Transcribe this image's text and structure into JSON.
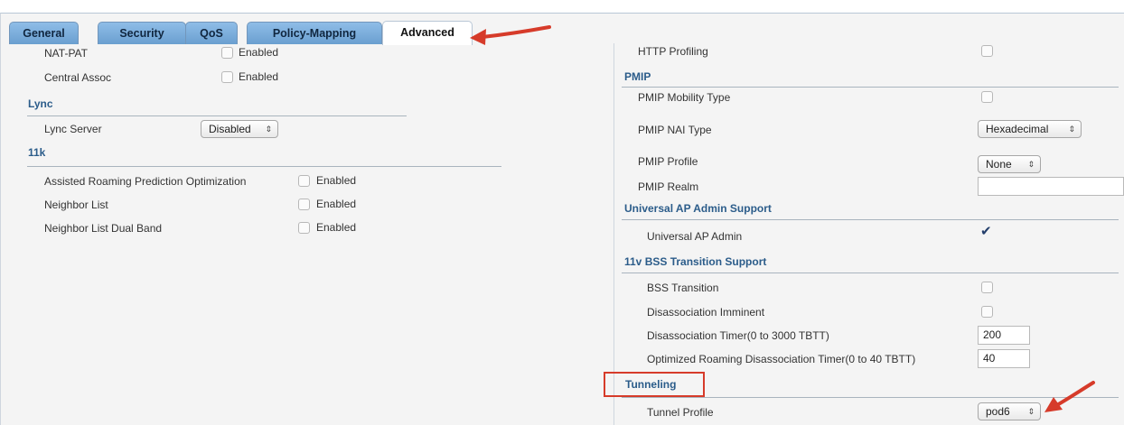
{
  "tabs": [
    {
      "label": "General"
    },
    {
      "label": "Security"
    },
    {
      "label": "QoS"
    },
    {
      "label": "Policy-Mapping"
    },
    {
      "label": "Advanced",
      "active": true
    }
  ],
  "left": {
    "nat_pat": {
      "label": "NAT-PAT",
      "value": "Enabled"
    },
    "central_assoc": {
      "label": "Central Assoc",
      "value": "Enabled"
    },
    "lync": {
      "section": "Lync",
      "server_label": "Lync Server",
      "server_value": "Disabled"
    },
    "k11": {
      "section": "11k",
      "items": [
        {
          "label": "Assisted Roaming Prediction Optimization",
          "value": "Enabled"
        },
        {
          "label": "Neighbor List",
          "value": "Enabled"
        },
        {
          "label": "Neighbor List Dual Band",
          "value": "Enabled"
        }
      ]
    }
  },
  "right": {
    "http_profiling": "HTTP Profiling",
    "pmip": {
      "section": "PMIP",
      "mobility_type": "PMIP Mobility Type",
      "nai_type_label": "PMIP NAI Type",
      "nai_type_value": "Hexadecimal",
      "profile_label": "PMIP Profile",
      "profile_value": "None",
      "realm_label": "PMIP Realm",
      "realm_value": ""
    },
    "universal": {
      "section": "Universal AP Admin Support",
      "admin_label": "Universal AP Admin",
      "admin_checked": true
    },
    "bss": {
      "section": "11v BSS Transition Support",
      "transition": "BSS Transition",
      "imminent": "Disassociation Imminent",
      "timer_label": "Disassociation Timer(0 to 3000 TBTT)",
      "timer_value": "200",
      "opt_timer_label": "Optimized Roaming Disassociation Timer(0 to 40 TBTT)",
      "opt_timer_value": "40"
    },
    "tunneling": {
      "section": "Tunneling",
      "profile_label": "Tunnel Profile",
      "profile_value": "pod6"
    }
  },
  "icons": {
    "select_arrow": "updown-arrow-icon",
    "annotation": "red-arrow-icon",
    "accent": "#d63b2a"
  }
}
